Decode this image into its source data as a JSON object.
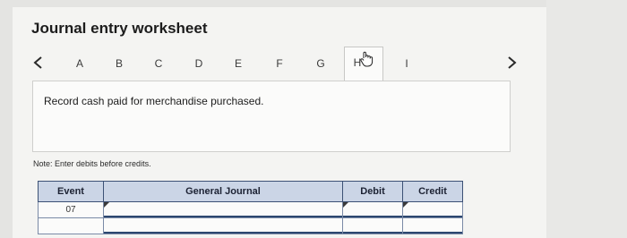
{
  "title": "Journal entry worksheet",
  "tabs": [
    {
      "label": "A"
    },
    {
      "label": "B"
    },
    {
      "label": "C"
    },
    {
      "label": "D"
    },
    {
      "label": "E"
    },
    {
      "label": "F"
    },
    {
      "label": "G"
    },
    {
      "label": "H",
      "active": true
    },
    {
      "label": "I"
    }
  ],
  "instruction": "Record cash paid for merchandise purchased.",
  "note": "Note: Enter debits before credits.",
  "table": {
    "headers": [
      "Event",
      "General Journal",
      "Debit",
      "Credit"
    ],
    "rows": [
      {
        "event": "07",
        "account": "",
        "debit": "",
        "credit": ""
      },
      {
        "event": "",
        "account": "",
        "debit": "",
        "credit": ""
      }
    ]
  },
  "icons": {
    "prev": "chevron-left-icon",
    "next": "chevron-right-icon",
    "cursor": "hand-pointer-icon"
  }
}
